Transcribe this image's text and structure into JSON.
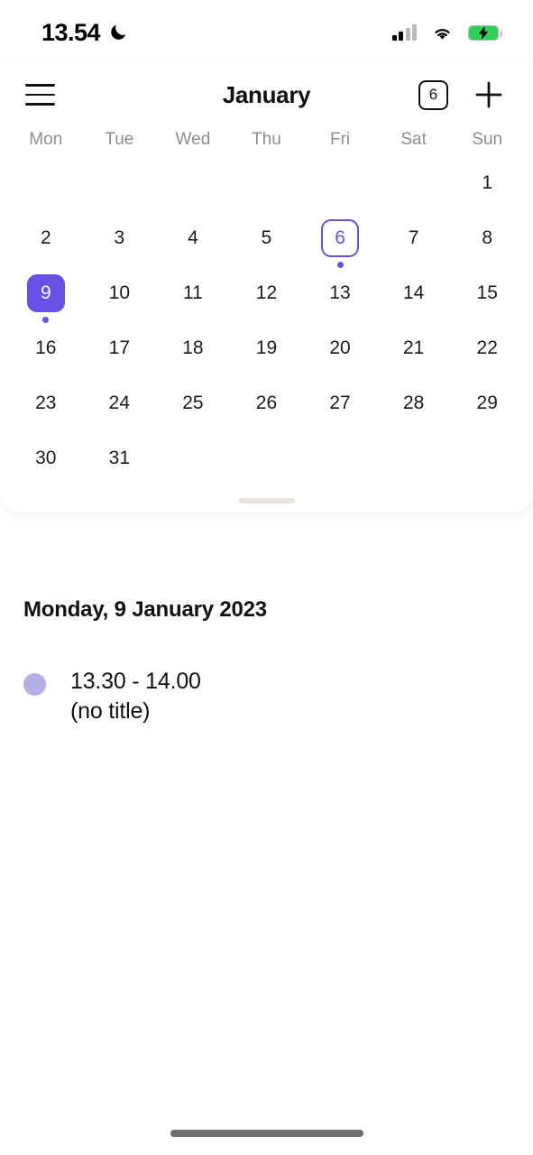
{
  "status_bar": {
    "time": "13.54",
    "dnd_icon": "moon-icon",
    "signal_icon": "cellular-signal-icon",
    "signal_bars_filled": 2,
    "signal_bars_total": 4,
    "wifi_icon": "wifi-icon",
    "battery_icon": "battery-charging-icon",
    "battery_charging": true,
    "battery_color": "#31d158"
  },
  "header": {
    "menu_icon": "hamburger-menu-icon",
    "title": "January",
    "today_badge": "6",
    "add_icon": "plus-icon"
  },
  "calendar": {
    "weekdays": [
      "Mon",
      "Tue",
      "Wed",
      "Thu",
      "Fri",
      "Sat",
      "Sun"
    ],
    "accent_color": "#6750e4",
    "weeks": [
      [
        {
          "day": "",
          "empty": true
        },
        {
          "day": "",
          "empty": true
        },
        {
          "day": "",
          "empty": true
        },
        {
          "day": "",
          "empty": true
        },
        {
          "day": "",
          "empty": true
        },
        {
          "day": "",
          "empty": true
        },
        {
          "day": "1"
        }
      ],
      [
        {
          "day": "2"
        },
        {
          "day": "3"
        },
        {
          "day": "4"
        },
        {
          "day": "5"
        },
        {
          "day": "6",
          "state": "today",
          "has_event": true
        },
        {
          "day": "7"
        },
        {
          "day": "8"
        }
      ],
      [
        {
          "day": "9",
          "state": "selected",
          "has_event": true
        },
        {
          "day": "10"
        },
        {
          "day": "11"
        },
        {
          "day": "12"
        },
        {
          "day": "13"
        },
        {
          "day": "14"
        },
        {
          "day": "15"
        }
      ],
      [
        {
          "day": "16"
        },
        {
          "day": "17"
        },
        {
          "day": "18"
        },
        {
          "day": "19"
        },
        {
          "day": "20"
        },
        {
          "day": "21"
        },
        {
          "day": "22"
        }
      ],
      [
        {
          "day": "23"
        },
        {
          "day": "24"
        },
        {
          "day": "25"
        },
        {
          "day": "26"
        },
        {
          "day": "27"
        },
        {
          "day": "28"
        },
        {
          "day": "29"
        }
      ],
      [
        {
          "day": "30"
        },
        {
          "day": "31"
        },
        {
          "day": "",
          "empty": true
        },
        {
          "day": "",
          "empty": true
        },
        {
          "day": "",
          "empty": true
        },
        {
          "day": "",
          "empty": true
        },
        {
          "day": "",
          "empty": true
        }
      ]
    ],
    "drag_handle": "sheet-drag-handle"
  },
  "agenda": {
    "date_heading": "Monday, 9 January 2023",
    "events": [
      {
        "dot_color": "#b4afe6",
        "time": "13.30 - 14.00",
        "title": "(no title)"
      }
    ]
  },
  "system": {
    "home_indicator": "home-indicator"
  }
}
